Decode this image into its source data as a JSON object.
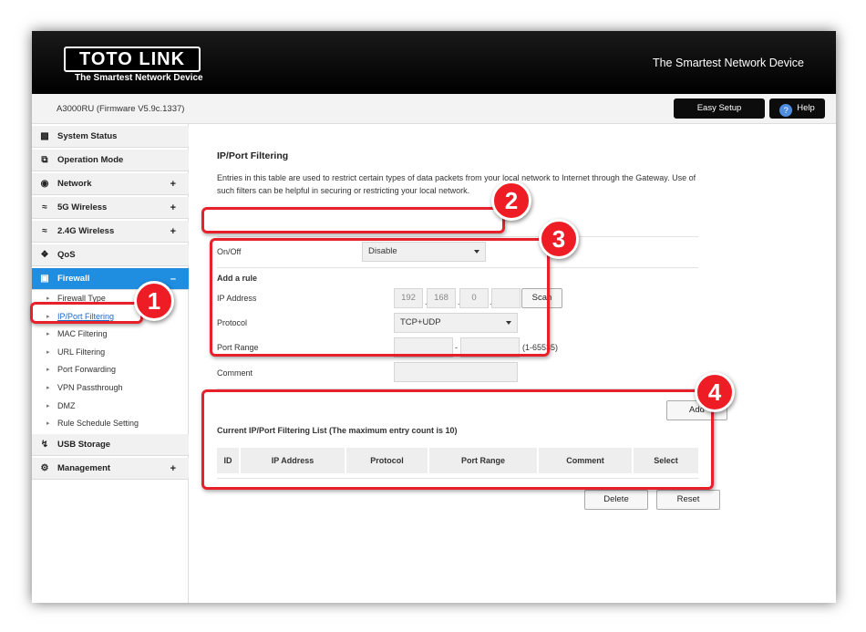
{
  "header": {
    "logo_text": "TOTO LINK",
    "logo_sub": "The Smartest Network Device",
    "tagline": "The Smartest Network Device"
  },
  "subbar": {
    "model": "A3000RU (Firmware V5.9c.1337)",
    "easy_setup": "Easy Setup",
    "help": "Help"
  },
  "sidebar": {
    "items": [
      {
        "label": "System Status",
        "icon": "chat-icon"
      },
      {
        "label": "Operation Mode",
        "icon": "windows-icon"
      },
      {
        "label": "Network",
        "icon": "globe-icon",
        "expand": "+"
      },
      {
        "label": "5G Wireless",
        "icon": "wifi-icon",
        "expand": "+"
      },
      {
        "label": "2.4G Wireless",
        "icon": "wifi-icon",
        "expand": "+"
      },
      {
        "label": "QoS",
        "icon": "qos-icon"
      },
      {
        "label": "Firewall",
        "icon": "lock-icon",
        "expand": "–"
      },
      {
        "label": "USB Storage",
        "icon": "usb-icon"
      },
      {
        "label": "Management",
        "icon": "gear-icon",
        "expand": "+"
      }
    ],
    "firewall_sub": [
      "Firewall Type",
      "IP/Port Filtering",
      "MAC Filtering",
      "URL Filtering",
      "Port Forwarding",
      "VPN Passthrough",
      "DMZ",
      "Rule Schedule Setting"
    ],
    "active_color": "#1f8de0"
  },
  "main": {
    "title": "IP/Port Filtering",
    "description": "Entries in this table are used to restrict certain types of data packets from your local network to Internet through the Gateway. Use of such filters can be helpful in securing or restricting your local network.",
    "onoff_label": "On/Off",
    "onoff_value": "Disable",
    "add_rule": "Add a rule",
    "ip_label": "IP Address",
    "ip": [
      "192",
      "168",
      "0",
      ""
    ],
    "scan": "Scan",
    "protocol_label": "Protocol",
    "protocol_value": "TCP+UDP",
    "port_label": "Port Range",
    "port_sep": "-",
    "port_hint": "(1-65535)",
    "comment_label": "Comment",
    "add": "Add",
    "list_title": "Current IP/Port Filtering List (The maximum entry count is 10)",
    "columns": [
      "ID",
      "IP Address",
      "Protocol",
      "Port Range",
      "Comment",
      "Select"
    ],
    "delete": "Delete",
    "reset": "Reset"
  },
  "annotations": {
    "badges": [
      "1",
      "2",
      "3",
      "4"
    ],
    "color": "#e8202a"
  }
}
